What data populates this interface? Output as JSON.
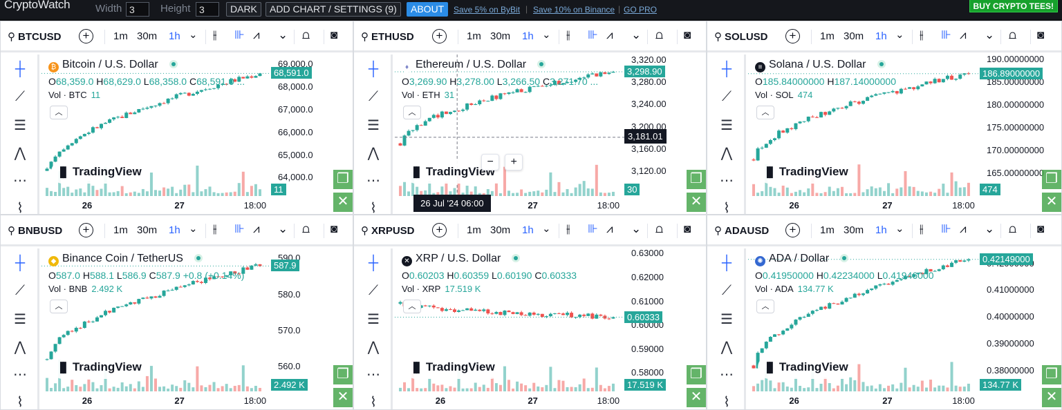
{
  "topbar": {
    "logo": "CryptoWatch",
    "width_label": "Width",
    "width_value": "3",
    "height_label": "Height",
    "height_value": "3",
    "dark_btn": "DARK",
    "add_chart_btn": "ADD CHART / SETTINGS (9)",
    "about_btn": "ABOUT",
    "link_bybit": "Save 5% on ByBit",
    "link_binance": "Save 10% on Binance",
    "link_gopro": "GO PRO",
    "tees_btn": "BUY CRYPTO TEES!"
  },
  "toolbar": {
    "intervals": [
      "1m",
      "30m",
      "1h"
    ],
    "active_interval": "1h",
    "chevron": "⌄"
  },
  "common": {
    "brand": "TradingView",
    "vol_prefix": "Vol · ",
    "tool_icons": [
      "crosshair-icon",
      "trend-line-icon",
      "fib-icon",
      "pattern-icon",
      "measure-icon",
      "brush-icon"
    ]
  },
  "panels": [
    {
      "symbol": "BTCUSD",
      "title": "Bitcoin / U.S. Dollar",
      "coin_color": "#f7931a",
      "coin_glyph": "₿",
      "ohlc": {
        "O": "68,359.0",
        "H": "68,629.0",
        "L": "68,358.0",
        "C": "68,591.0",
        "tail": " ..."
      },
      "vol_sym": "BTC",
      "vol_val": "11",
      "price_badge": "68,591.0",
      "vol_badge": "11",
      "yticks": [
        "69,000.0",
        "68,000.0",
        "67,000.0",
        "66,000.0",
        "65,000.0",
        "64,000.0"
      ],
      "xticks": [
        "26",
        "27",
        "18:00"
      ],
      "chart_data": {
        "type": "candlestick",
        "y_range": [
          63800,
          69300
        ],
        "start": 64300,
        "end": 68591,
        "last": 68591
      }
    },
    {
      "symbol": "ETHUSD",
      "title": "Ethereum / U.S. Dollar",
      "coin_color": "#ffffff",
      "coin_glyph": "♦",
      "ohlc": {
        "O": "3,269.90",
        "H": "3,278.00",
        "L": "3,266.50",
        "C": "3,271.70",
        "tail": " ..."
      },
      "vol_sym": "ETH",
      "vol_val": "31",
      "price_badge": "3,298.90",
      "vol_badge": "30",
      "yticks": [
        "3,320.00",
        "3,280.00",
        "3,240.00",
        "3,200.00",
        "3,160.00",
        "3,120.00"
      ],
      "xticks": [
        "26",
        "27",
        "18:00"
      ],
      "crosshair_price": "3,181.01",
      "crosshair_time": "26 Jul '24   06:00",
      "zoom_minus": "−",
      "zoom_plus": "+",
      "chart_data": {
        "type": "candlestick",
        "y_range": [
          3100,
          3325
        ],
        "start": 3170,
        "end": 3298.9,
        "last": 3298.9
      }
    },
    {
      "symbol": "SOLUSD",
      "title": "Solana / U.S. Dollar",
      "coin_color": "#131722",
      "coin_glyph": "≡",
      "ohlc": {
        "O": "185.84000000",
        "H": "187.14000000",
        "L": "",
        "C": "",
        "tail": ""
      },
      "vol_sym": "SOL",
      "vol_val": "474",
      "price_badge": "186.89000000",
      "vol_badge": "474",
      "yticks": [
        "190.00000000",
        "185.00000000",
        "180.00000000",
        "175.00000000",
        "170.00000000",
        "165.00000000"
      ],
      "xticks": [
        "26",
        "27",
        "18:00"
      ],
      "chart_data": {
        "type": "candlestick",
        "y_range": [
          163,
          190.5
        ],
        "start": 168,
        "end": 186.89,
        "last": 186.89
      }
    },
    {
      "symbol": "BNBUSD",
      "title": "Binance Coin / TetherUS",
      "coin_color": "#f0b90b",
      "coin_glyph": "◆",
      "ohlc": {
        "O": "587.0",
        "H": "588.1",
        "L": "586.9",
        "C": "587.9",
        "tail": " +0.8 (+0.14%)"
      },
      "vol_sym": "BNB",
      "vol_val": "2.492 K",
      "price_badge": "587.9",
      "vol_badge": "2.492 K",
      "yticks": [
        "590.0",
        "580.0",
        "570.0",
        "560.0"
      ],
      "xticks": [
        "26",
        "27",
        "18:00"
      ],
      "chart_data": {
        "type": "candlestick",
        "y_range": [
          557,
          592
        ],
        "start": 562,
        "end": 587.9,
        "last": 587.9
      }
    },
    {
      "symbol": "XRPUSD",
      "title": "XRP / U.S. Dollar",
      "coin_color": "#131722",
      "coin_glyph": "✕",
      "ohlc": {
        "O": "0.60203",
        "H": "0.60359",
        "L": "0.60190",
        "C": "0.60333",
        "tail": ""
      },
      "vol_sym": "XRP",
      "vol_val": "17.519 K",
      "price_badge": "0.60333",
      "vol_badge": "17.519 K",
      "yticks": [
        "0.63000",
        "0.62000",
        "0.61000",
        "0.60000",
        "0.59000",
        "0.58000"
      ],
      "xticks": [
        "26",
        "27",
        "18:00"
      ],
      "chart_data": {
        "type": "candlestick",
        "y_range": [
          0.578,
          0.631
        ],
        "start": 0.609,
        "end": 0.60333,
        "last": 0.60333
      }
    },
    {
      "symbol": "ADAUSD",
      "title": "ADA / Dollar",
      "coin_color": "#3468d1",
      "coin_glyph": "✺",
      "ohlc": {
        "O": "0.41950000",
        "H": "0.42234000",
        "L": "0.41946000",
        "C": "",
        "tail": ""
      },
      "vol_sym": "ADA",
      "vol_val": "134.77 K",
      "price_badge": "0.42149000",
      "vol_badge": "134.77 K",
      "yticks": [
        "0.42000000",
        "0.41000000",
        "0.40000000",
        "0.39000000",
        "0.38000000"
      ],
      "xticks": [
        "26",
        "27",
        "18:00"
      ],
      "chart_data": {
        "type": "candlestick",
        "y_range": [
          0.3775,
          0.4245
        ],
        "start": 0.382,
        "end": 0.42149,
        "last": 0.42149
      }
    }
  ]
}
